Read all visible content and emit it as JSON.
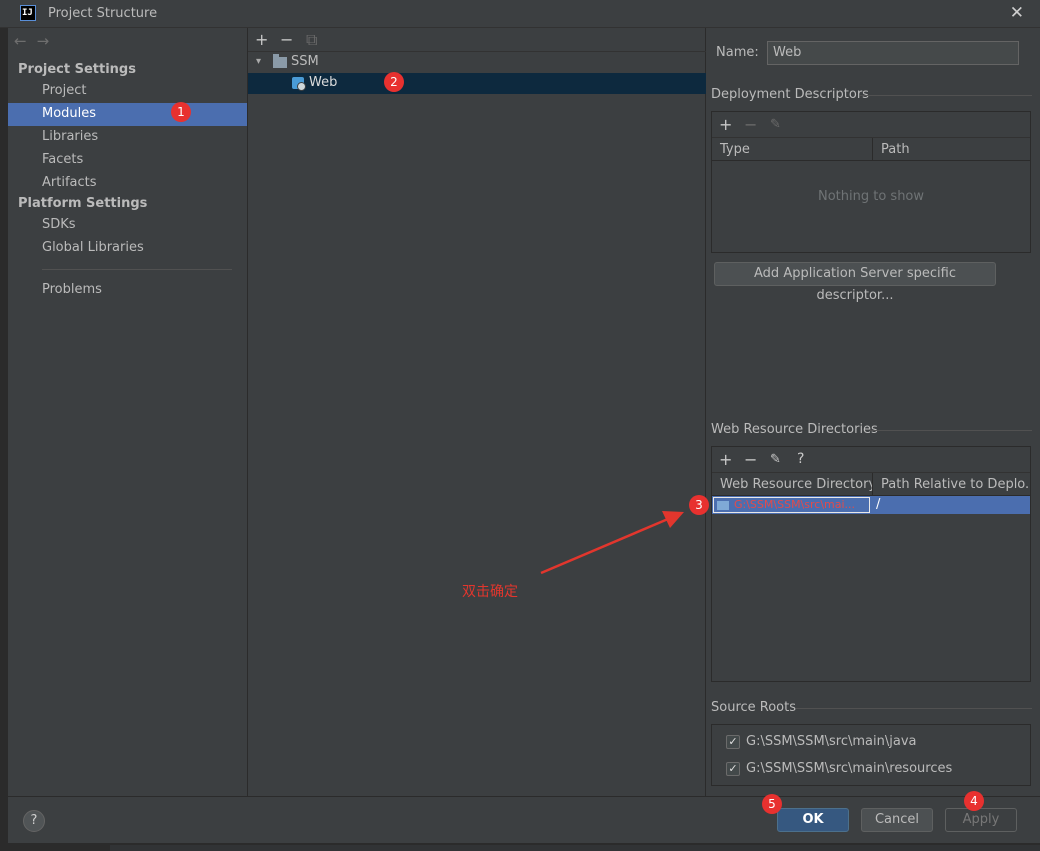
{
  "window": {
    "title": "Project Structure",
    "app_icon_text": "IJ",
    "close_glyph": "✕"
  },
  "leftnav": {
    "back_glyph": "←",
    "forward_glyph": "→",
    "project_settings_header": "Project Settings",
    "project_settings_items": [
      "Project",
      "Modules",
      "Libraries",
      "Facets",
      "Artifacts"
    ],
    "selected_item": "Modules",
    "platform_settings_header": "Platform Settings",
    "platform_settings_items": [
      "SDKs",
      "Global Libraries"
    ],
    "problems_label": "Problems"
  },
  "tree": {
    "toolbar": {
      "add": "+",
      "remove": "−",
      "copy": "⧉"
    },
    "root_label": "SSM",
    "child_label": "Web",
    "chevron": "▾"
  },
  "details": {
    "name_label": "Name:",
    "name_value": "Web",
    "deployment_descriptors": {
      "title": "Deployment Descriptors",
      "columns": [
        "Type",
        "Path"
      ],
      "empty_text": "Nothing to show",
      "add_server_button": "Add Application Server specific descriptor..."
    },
    "web_resource_directories": {
      "title": "Web Resource Directories",
      "columns": [
        "Web Resource Directory",
        "Path Relative to Deplo..."
      ],
      "rows": [
        {
          "directory": "G:\\SSM\\SSM\\src\\mai...",
          "path": "/"
        }
      ],
      "help_glyph": "?"
    },
    "source_roots": {
      "title": "Source Roots",
      "items": [
        {
          "path": "G:\\SSM\\SSM\\src\\main\\java",
          "checked": true
        },
        {
          "path": "G:\\SSM\\SSM\\src\\main\\resources",
          "checked": true
        }
      ],
      "check_glyph": "✓"
    }
  },
  "footer": {
    "help": "?",
    "ok": "OK",
    "cancel": "Cancel",
    "apply": "Apply"
  },
  "annotations": {
    "badges": [
      "1",
      "2",
      "3",
      "4",
      "5"
    ],
    "note": "双击确定",
    "color": "#e8312f"
  }
}
